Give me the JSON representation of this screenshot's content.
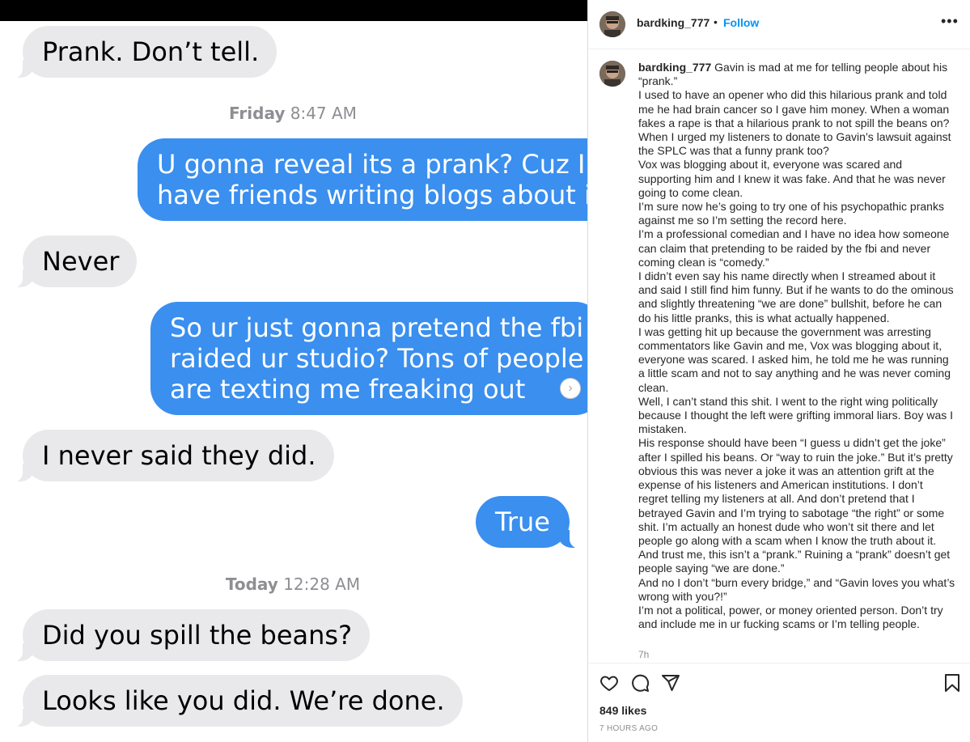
{
  "conversation": {
    "messages": [
      {
        "from": "them",
        "text": "Prank. Don’t tell."
      },
      {
        "from": "me",
        "text_lines": [
          "U gonna reveal its a prank? Cuz I",
          "have friends writing blogs about it"
        ]
      },
      {
        "from": "them",
        "text": "Never"
      },
      {
        "from": "me",
        "text_lines": [
          "So ur just gonna pretend the fbi",
          "raided ur studio? Tons of people",
          "are texting me freaking out"
        ]
      },
      {
        "from": "them",
        "text": "I never said they did."
      },
      {
        "from": "me",
        "text": "True"
      },
      {
        "from": "them",
        "text": "Did you spill the beans?"
      },
      {
        "from": "them",
        "text": "Looks like you did. We’re done."
      }
    ],
    "timestamps": [
      {
        "day": "Friday",
        "time": "8:47 AM"
      },
      {
        "day": "Today",
        "time": "12:28 AM"
      }
    ]
  },
  "instagram": {
    "header": {
      "username": "bardking_777",
      "separator": "•",
      "follow_label": "Follow",
      "more_icon": "more-horizontal-icon"
    },
    "caption": {
      "username": "bardking_777",
      "lines": [
        " Gavin is mad at me for telling people about his “prank.”",
        "I used to have an opener who did this hilarious prank and told me he had brain cancer so I gave him money. When a woman fakes a rape is that a hilarious prank to not spill the beans on? When I urged my listeners to donate to Gavin’s lawsuit against the SPLC was that a funny prank too?",
        "Vox was blogging about it, everyone was scared and supporting him and I knew it was fake. And that he was never going to come clean.",
        "I’m sure now he’s going to try one of his psychopathic pranks against me so I’m setting the record here.",
        "I’m a professional comedian and I have no idea how someone can claim that pretending to be raided by the fbi and never coming clean is “comedy.”",
        "I didn’t even say his name directly when I streamed about it and said I still find him funny. But if he wants to do the ominous and slightly threatening “we are done” bullshit, before he can do his little pranks, this is what actually happened.",
        "I was getting hit up because the government was arresting commentators like Gavin and me, Vox was blogging about it, everyone was scared. I asked him, he told me he was running a little scam and not to say anything and he was never coming clean.",
        "Well, I can’t stand this shit. I went to the right wing politically because I thought the left were grifting immoral liars. Boy was I mistaken.",
        "His response should have been “I guess u didn’t get the joke” after I spilled his beans. Or “way to ruin the joke.” But it’s pretty obvious this was never a joke it was an attention grift at the expense of his listeners and American institutions. I don’t regret telling my listeners at all. And don’t pretend that I betrayed Gavin and I’m trying to sabotage “the right” or some shit. I’m actually an honest dude who won’t sit there and let people go along with a scam when I know the truth about it.",
        "And trust me, this isn’t a “prank.” Ruining a “prank” doesn’t get people saying “we are done.”",
        "And no I don’t “burn every bridge,” and “Gavin loves you what’s wrong with you?!”",
        "I’m not a political, power, or money oriented person. Don’t try and include me in ur fucking scams or I’m telling people."
      ],
      "time_ago": "7h"
    },
    "actions": {
      "like_icon": "heart-icon",
      "comment_icon": "comment-icon",
      "share_icon": "share-icon",
      "save_icon": "bookmark-icon"
    },
    "likes": "849 likes",
    "posted": "7 HOURS AGO"
  }
}
